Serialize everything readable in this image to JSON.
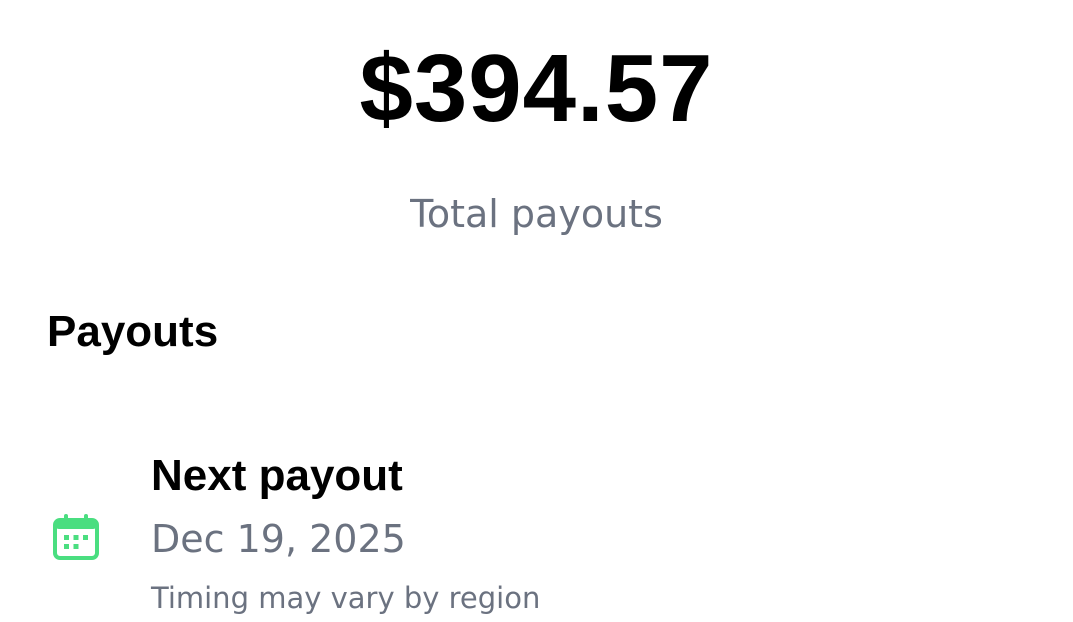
{
  "summary": {
    "total_amount": "$394.57",
    "total_label": "Total payouts"
  },
  "payouts": {
    "section_title": "Payouts",
    "next": {
      "icon": "calendar-icon",
      "icon_color": "#4ade80",
      "title": "Next payout",
      "date": "Dec 19, 2025",
      "note": "Timing may vary by region"
    }
  },
  "colors": {
    "primary_text": "#000000",
    "secondary_text": "#6b7280",
    "background": "#ffffff"
  }
}
